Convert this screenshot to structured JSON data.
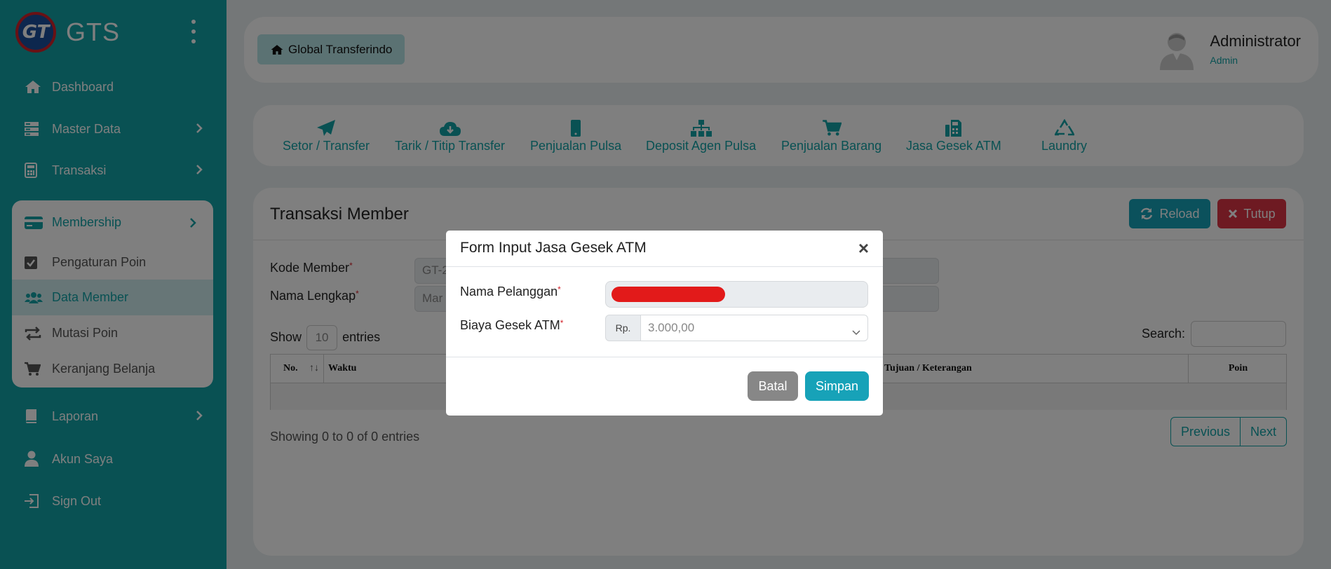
{
  "colors": {
    "teal": "#12a3a7",
    "danger": "#d3222b",
    "muted": "#8e8e8e"
  },
  "brand": {
    "logo_text": "GT",
    "name": "GTS"
  },
  "sidebar": {
    "items": [
      {
        "label": "Dashboard",
        "icon": "home-icon"
      },
      {
        "label": "Master Data",
        "icon": "server-icon"
      },
      {
        "label": "Transaksi",
        "icon": "calculator-icon"
      },
      {
        "label": "Laporan",
        "icon": "book-icon"
      },
      {
        "label": "Akun Saya",
        "icon": "user-icon"
      },
      {
        "label": "Sign Out",
        "icon": "sign-out-icon"
      }
    ],
    "membership": {
      "label": "Membership",
      "children": [
        {
          "label": "Pengaturan Poin",
          "icon": "check-square-icon"
        },
        {
          "label": "Data Member",
          "icon": "users-icon"
        },
        {
          "label": "Mutasi Poin",
          "icon": "exchange-icon"
        },
        {
          "label": "Keranjang Belanja",
          "icon": "cart-icon"
        }
      ]
    }
  },
  "topbar": {
    "breadcrumb": "Global Transferindo",
    "user_name": "Administrator",
    "user_role": "Admin"
  },
  "shortcuts": [
    {
      "label": "Setor / Transfer",
      "icon": "paper-plane-icon"
    },
    {
      "label": "Tarik / Titip Transfer",
      "icon": "cloud-download-icon"
    },
    {
      "label": "Penjualan Pulsa",
      "icon": "mobile-icon"
    },
    {
      "label": "Deposit Agen Pulsa",
      "icon": "sitemap-icon"
    },
    {
      "label": "Penjualan Barang",
      "icon": "cart-icon"
    },
    {
      "label": "Jasa Gesek ATM",
      "icon": "fax-icon"
    },
    {
      "label": "Laundry",
      "icon": "recycle-icon"
    }
  ],
  "panel": {
    "title": "Transaksi Member",
    "reload_label": "Reload",
    "close_label": "Tutup",
    "kode_member_label": "Kode Member",
    "kode_member_value": "GT-2",
    "nama_lengkap_label": "Nama Lengkap",
    "nama_lengkap_value": "Mar",
    "show_label": "Show",
    "entries_value": "10",
    "entries_label": "entries",
    "search_label": "Search:",
    "columns": [
      "No.",
      "Waktu",
      "Tujuan / Keterangan",
      "Poin"
    ],
    "info": "Showing 0 to 0 of 0 entries",
    "prev_label": "Previous",
    "next_label": "Next"
  },
  "modal": {
    "title": "Form Input Jasa Gesek ATM",
    "close_glyph": "×",
    "nama_label": "Nama Pelanggan",
    "biaya_label": "Biaya Gesek ATM",
    "required_mark": "*",
    "prefix": "Rp.",
    "biaya_value": "3.000,00",
    "cancel_label": "Batal",
    "save_label": "Simpan"
  }
}
